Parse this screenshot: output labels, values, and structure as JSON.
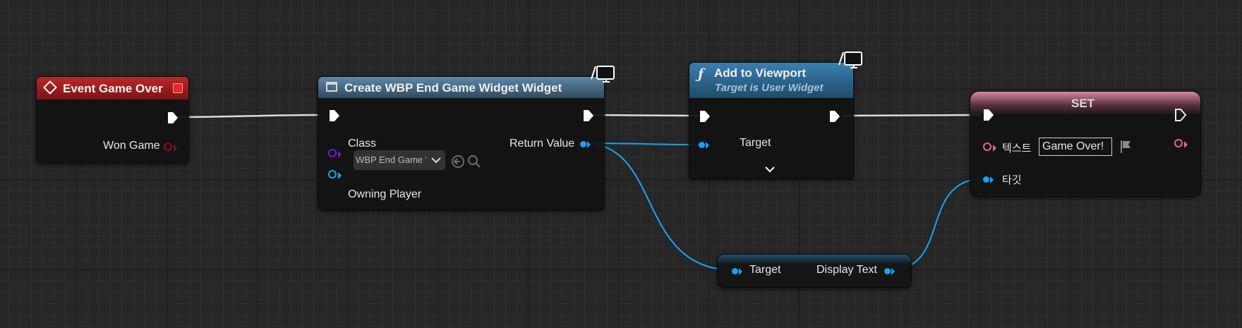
{
  "colors": {
    "background": "#262626",
    "event_header": "#9e1b1b",
    "widget_header": "#4a6f8a",
    "function_header": "#2d6d96",
    "set_header": "#c86f8f",
    "wire_exec": "#dcdcdc",
    "wire_object": "#15a4f4"
  },
  "event_node": {
    "title": "Event Game Over",
    "icon": "event-diamond-icon",
    "output_pin_label": "Won Game"
  },
  "create_widget_node": {
    "title": "Create WBP End Game Widget Widget",
    "icon": "widget-window-icon",
    "class_label": "Class",
    "class_value": "WBP End Game Widget",
    "owning_player_label": "Owning Player",
    "return_value_label": "Return Value"
  },
  "add_to_viewport_node": {
    "title": "Add to Viewport",
    "subtitle": "Target is User Widget",
    "icon": "function-icon",
    "target_label": "Target"
  },
  "set_node": {
    "title": "SET",
    "text_label": "텍스트",
    "text_value": "Game Over!",
    "target_label": "타깃"
  },
  "display_text_node": {
    "target_label": "Target",
    "output_label": "Display Text"
  }
}
